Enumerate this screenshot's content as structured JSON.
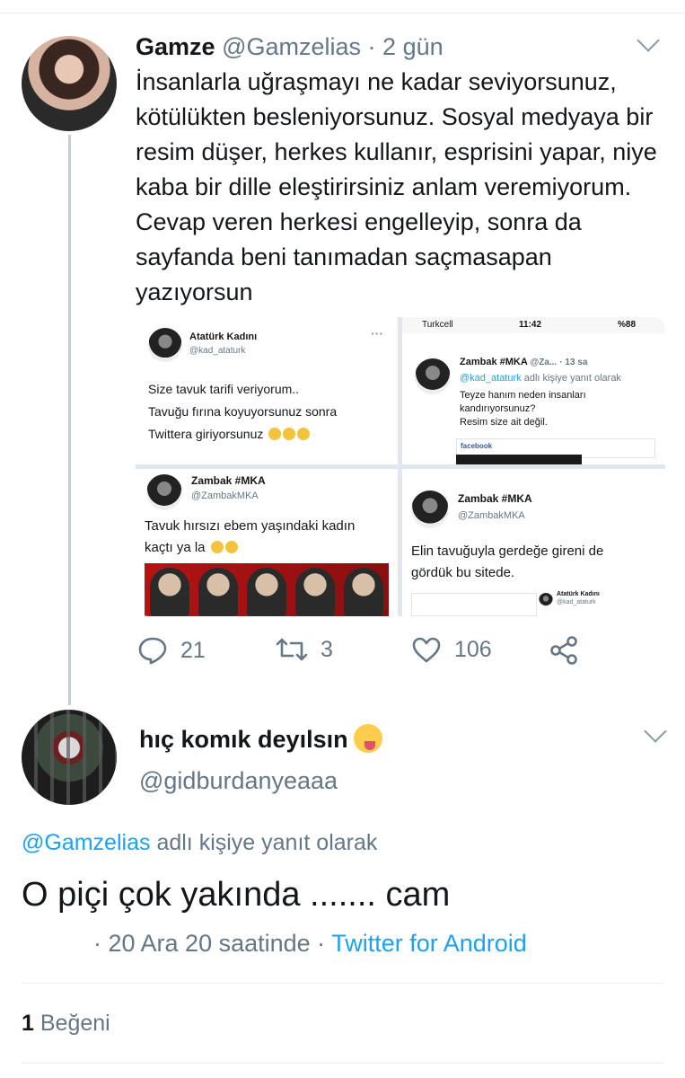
{
  "colors": {
    "accent": "#1da1f2",
    "muted": "#657786",
    "text": "#14171a",
    "thread_line": "#c4cfd6"
  },
  "tweet": {
    "author_name": "Gamze",
    "author_handle": "@Gamzelias",
    "time": "2 gün",
    "text": "İnsanlarla uğraşmayı ne kadar seviyorsunuz, kötülükten besleniyorsunuz. Sosyal medyaya bir resim düşer, herkes kullanır, esprisini yapar, niye kaba bir dille eleştirirsiniz anlam veremiyorum. Cevap veren herkesi engelleyip, sonra da sayfanda beni tanımadan saçmasapan yazıyorsun",
    "media": {
      "img1": {
        "name": "Atatürk Kadını",
        "handle": "@kad_ataturk",
        "text_lines": [
          "Size tavuk tarifi veriyorum..",
          "Tavuğu fırına koyuyorsunuz sonra",
          "Twittera giriyorsunuz"
        ]
      },
      "img2": {
        "carrier": "Turkcell",
        "clock": "11:42",
        "battery": "%88",
        "name": "Zambak #MKA",
        "handle": "@Za...",
        "time": "13 sa",
        "reply_handle": "@kad_ataturk",
        "reply_suffix": "adlı kişiye yanıt olarak",
        "text_lines": [
          "Teyze hanım neden insanları",
          "kandırıyorsunuz?",
          "Resim size ait değil."
        ],
        "fb_label": "facebook"
      },
      "img3": {
        "name": "Zambak #MKA",
        "handle": "@ZambakMKA",
        "text_lines": [
          "Tavuk hırsızı ebem yaşındaki kadın",
          "kaçtı ya la"
        ]
      },
      "img4": {
        "name": "Zambak #MKA",
        "handle": "@ZambakMKA",
        "text_lines": [
          "Elin tavuğuyla gerdeğe gireni de",
          "gördük bu sitede."
        ],
        "mini_name": "Atatürk Kadını",
        "mini_handle": "@kad_ataturk"
      }
    },
    "actions": {
      "replies": "21",
      "retweets": "3",
      "likes": "106"
    }
  },
  "reply": {
    "author_name": "hıç komık deyılsın",
    "author_handle": "@gidburdanyeaaa",
    "replying_handle": "@Gamzelias",
    "replying_suffix": "adlı kişiye yanıt olarak",
    "text": "O piçi çok yakında ....... cam",
    "date": "· 20 Ara 20 saatinde ·",
    "source": "Twitter for Android",
    "like_count": "1",
    "like_label": "Beğeni"
  }
}
